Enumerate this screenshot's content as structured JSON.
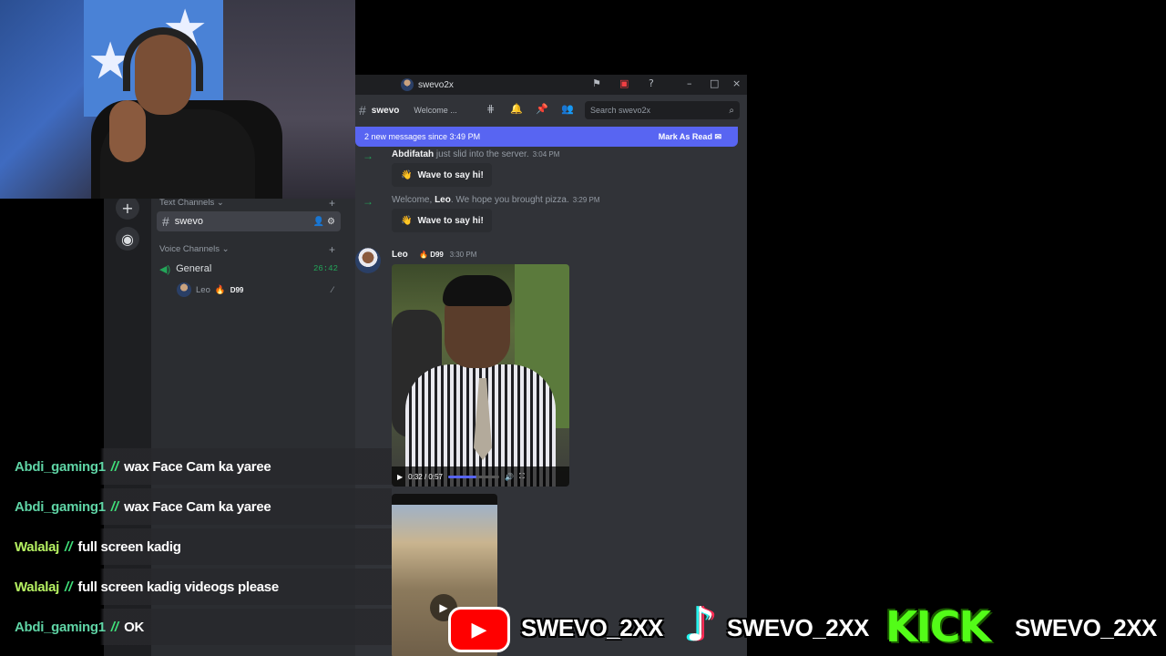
{
  "titlebar": {
    "server": "swevo2x"
  },
  "header": {
    "channel": "swevo",
    "topic": "Welcome ...",
    "search_placeholder": "Search swevo2x"
  },
  "banner": {
    "text": "2 new messages since 3:49 PM",
    "action": "Mark As Read"
  },
  "sidebar": {
    "text_category": "Text Channels",
    "text_channel": "swevo",
    "voice_category": "Voice Channels",
    "voice_channel": "General",
    "voice_timer": "26:42",
    "voice_user": "Leo",
    "voice_user_badge": "D99"
  },
  "messages": {
    "join1_user": "Abdifatah",
    "join1_text": "just slid into the server.",
    "join1_time": "3:04 PM",
    "wave_label": "Wave to say hi!",
    "join2_prefix": "Welcome,",
    "join2_user": "Leo",
    "join2_text": ". We hope you brought pizza.",
    "join2_time": "3:29 PM",
    "leo_name": "Leo",
    "leo_badge": "D99",
    "leo_time": "3:30 PM",
    "video_time": "0:32 / 0:57",
    "video_progress": 0.56
  },
  "chat": [
    {
      "user": "Abdi_gaming1",
      "msg": "wax Face Cam ka yaree"
    },
    {
      "user": "Abdi_gaming1",
      "msg": "wax Face Cam ka yaree"
    },
    {
      "user": "Walalaj",
      "msg": "full screen kadig"
    },
    {
      "user": "Walalaj",
      "msg": "full screen kadig videogs please"
    },
    {
      "user": "Abdi_gaming1",
      "msg": "OK"
    }
  ],
  "socials": {
    "youtube": "SWEVO_2XX",
    "tiktok": "SWEVO_2XX",
    "kick_logo": "KICK",
    "kick": "SWEVO_2XX"
  }
}
